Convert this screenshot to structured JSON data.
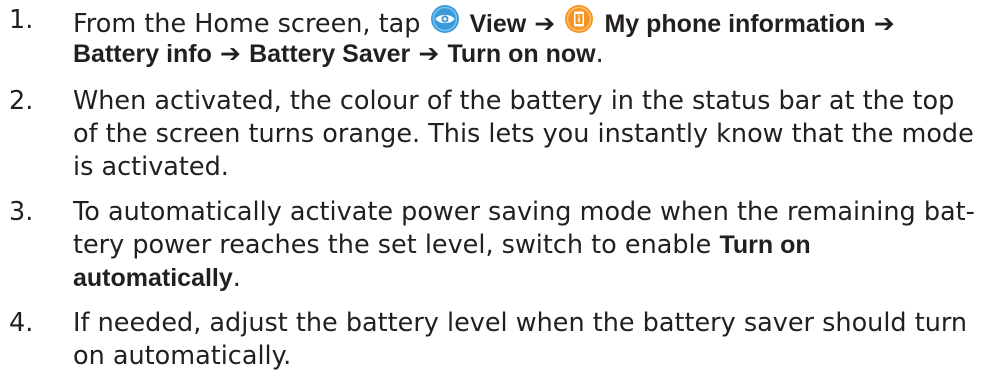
{
  "steps": [
    {
      "number": "1.",
      "prefix": "From the Home screen, tap",
      "view_label": "View",
      "my_phone_label": "My phone information",
      "battery_info_label": "Battery info",
      "battery_saver_label": "Battery Saver",
      "turn_on_now_label": "Turn on now",
      "suffix": ".",
      "icons": [
        "view-eye-icon",
        "phone-info-icon"
      ],
      "arrow": "➔",
      "colors": {
        "view_icon": "#3a9ad9",
        "phone_icon": "#f7941d"
      }
    },
    {
      "number": "2.",
      "lines": [
        "When activated, the colour of the battery in the status bar at the top",
        "of the screen turns orange. This lets you instantly know that the mode",
        "is activated."
      ]
    },
    {
      "number": "3.",
      "line1": "To automatically activate power saving mode when the remaining bat-",
      "line2_prefix": "tery power reaches the set level, switch to enable",
      "bold_part1": "Turn on",
      "bold_part2": "automatically",
      "suffix": "."
    },
    {
      "number": "4.",
      "lines": [
        "If needed, adjust the battery level when the battery saver should turn",
        "on automatically."
      ]
    }
  ]
}
